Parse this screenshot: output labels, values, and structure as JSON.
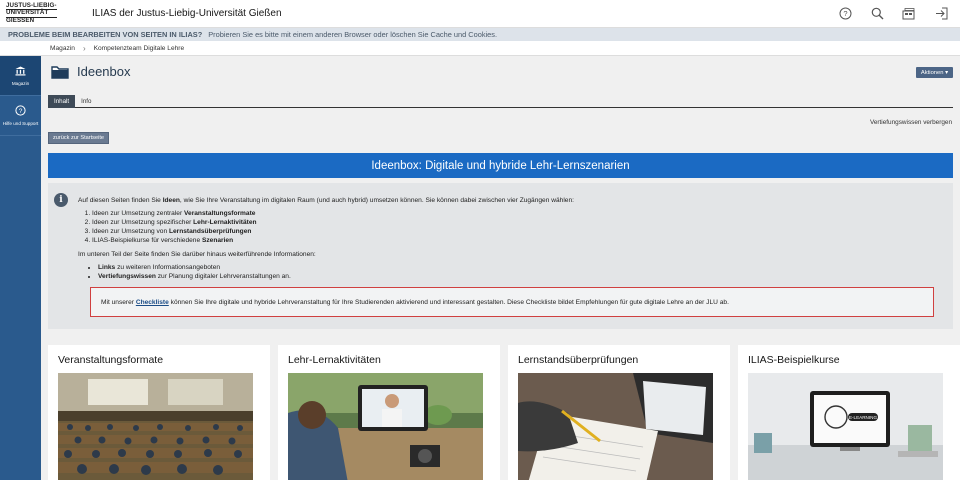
{
  "header": {
    "logo_lines": [
      "JUSTUS-LIEBIG-",
      "UNIVERSITÄT",
      "GIESSEN"
    ],
    "brand": "ILIAS der Justus-Liebig-Universität Gießen",
    "tools": [
      "help-icon",
      "search-icon",
      "notifications-icon",
      "logout-icon"
    ]
  },
  "notice": {
    "title": "PROBLEME BEIM BEARBEITEN VON SEITEN IN ILIAS?",
    "text": "Probieren Sie es bitte mit einem anderen Browser oder löschen Sie Cache und Cookies."
  },
  "breadcrumb": [
    "Magazin",
    "Kompetenzteam Digitale Lehre"
  ],
  "sidebar": {
    "items": [
      {
        "label": "Magazin",
        "icon": "repository-icon"
      },
      {
        "label": "Hilfe und Support",
        "icon": "help-circle-icon"
      }
    ]
  },
  "page": {
    "title": "Ideenbox",
    "actions_label": "Aktionen ▾",
    "tabs": [
      {
        "label": "Inhalt",
        "active": true
      },
      {
        "label": "Info",
        "active": false
      }
    ],
    "toggle_label": "Vertiefungswissen verbergen",
    "back_label": "zurück zur Startseite",
    "banner": "Ideenbox: Digitale und hybride Lehr-Lernszenarien"
  },
  "info": {
    "intro_prefix": "Auf diesen Seiten finden Sie ",
    "intro_bold": "Ideen",
    "intro_suffix": ", wie Sie Ihre Veranstaltung im digitalen Raum (und auch hybrid) umsetzen können. Sie können dabei zwischen vier Zugängen wählen:",
    "list": [
      {
        "prefix": "Ideen zur Umsetzung zentraler ",
        "bold": "Veranstaltungsformate"
      },
      {
        "prefix": "Ideen zur Umsetzung spezifischer ",
        "bold": "Lehr-Lernaktivitäten"
      },
      {
        "prefix": "Ideen zur Umsetzung von ",
        "bold": "Lernstandsüberprüfungen"
      },
      {
        "prefix": "ILIAS-Beispielkurse für verschiedene ",
        "bold": "Szenarien"
      }
    ],
    "more": "Im unteren Teil der Seite finden Sie darüber hinaus weiterführende Informationen:",
    "bullets": [
      {
        "bold": "Links",
        "suffix": " zu weiteren Informationsangeboten"
      },
      {
        "bold": "Vertiefungswissen",
        "suffix": " zur Planung digitaler Lehrveranstaltungen an."
      }
    ],
    "checklist_prefix": "Mit unserer ",
    "checklist_link": "Checkliste",
    "checklist_suffix": " können Sie Ihre digitale und hybride Lehrveranstaltung für Ihre Studierenden aktivierend und interessant gestalten. Diese Checkliste bildet Empfehlungen für gute digitale Lehre an der JLU ab."
  },
  "cards": [
    {
      "title": "Veranstaltungsformate"
    },
    {
      "title": "Lehr-Lernaktivitäten"
    },
    {
      "title": "Lernstandsüberprüfungen"
    },
    {
      "title": "ILIAS-Beispielkurse"
    }
  ],
  "colors": {
    "banner": "#1b6ac3",
    "sidebar": "#2a5a8d",
    "highlight_border": "#d04040"
  }
}
